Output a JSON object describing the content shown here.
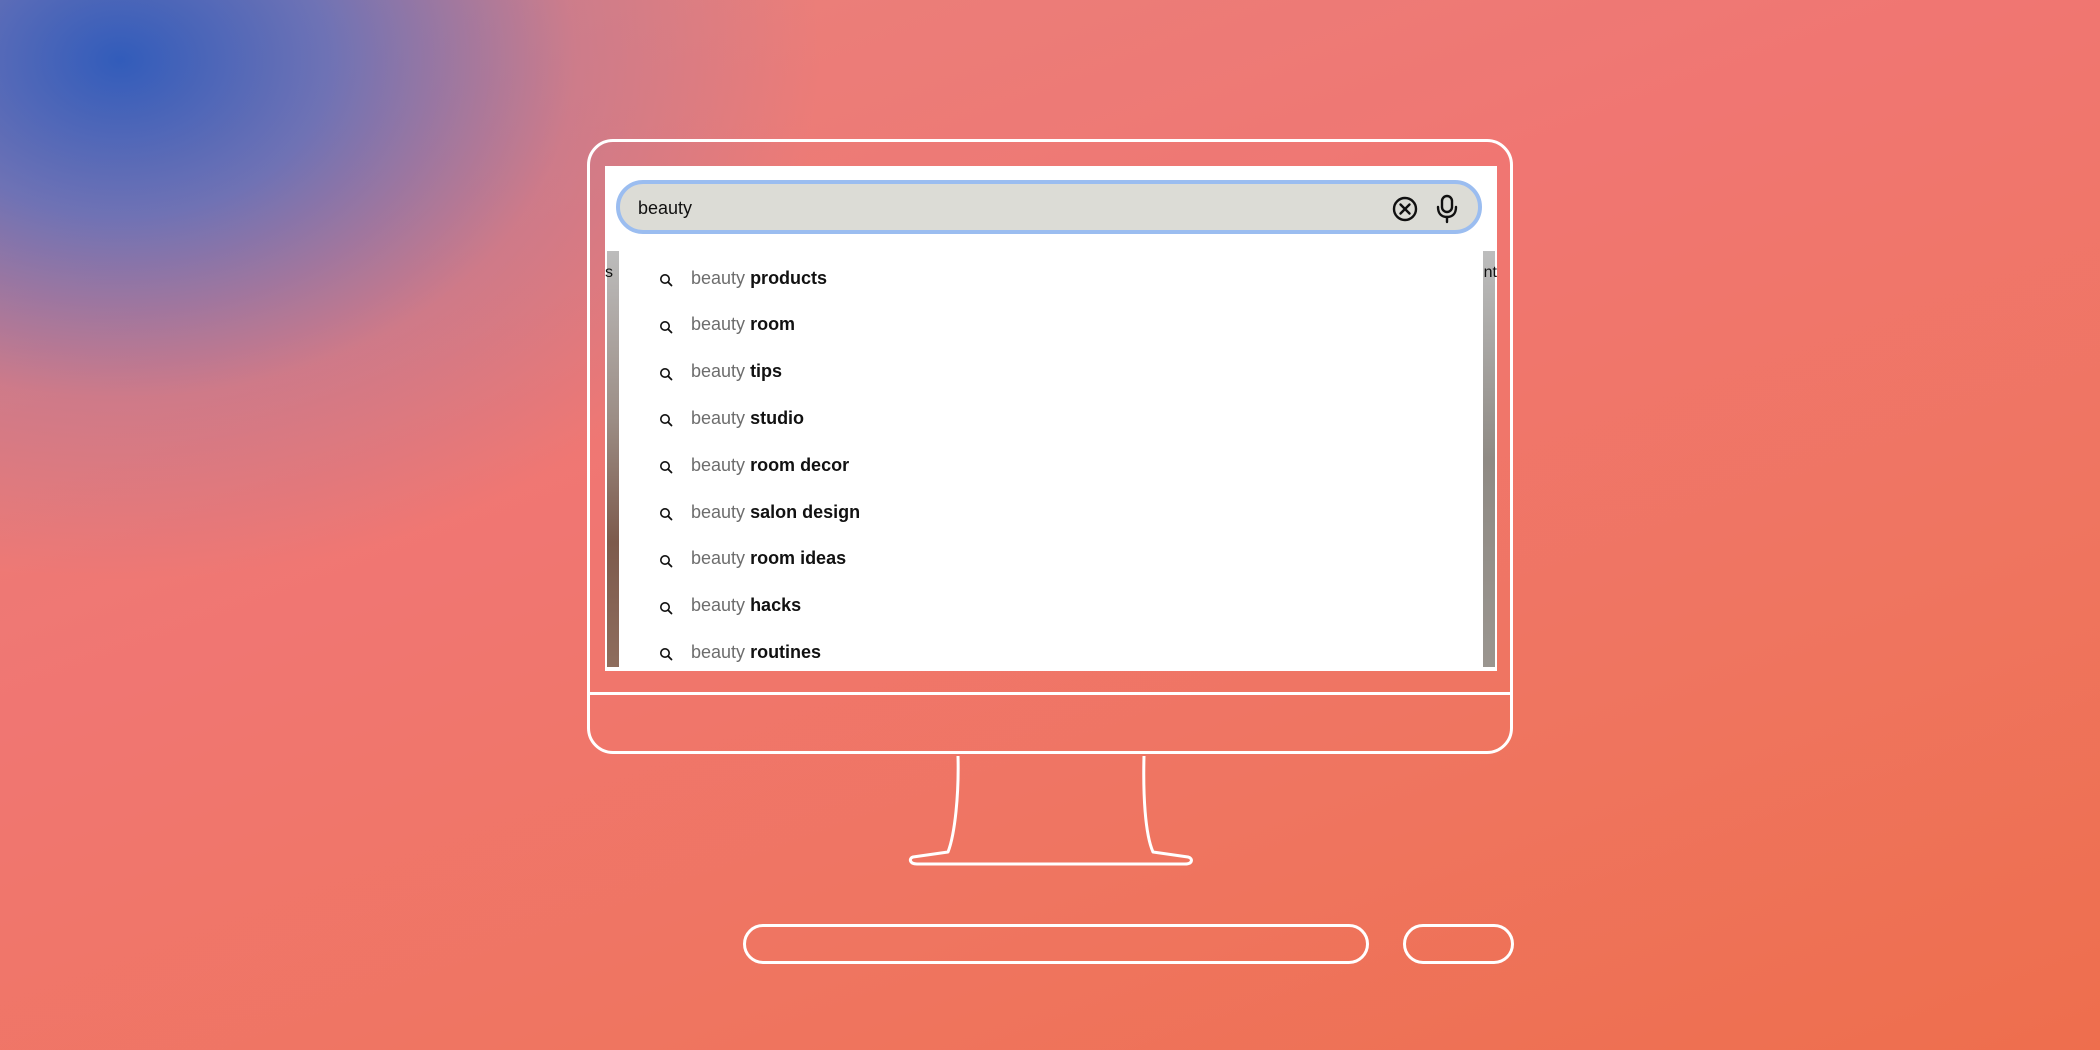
{
  "search": {
    "value": "beauty",
    "clear_icon": "clear-circle-x-icon",
    "mic_icon": "microphone-icon"
  },
  "background_fragments": {
    "left": "s",
    "right": "nt"
  },
  "suggestions": [
    {
      "prefix": "beauty",
      "suffix": "products",
      "icon": "search-icon"
    },
    {
      "prefix": "beauty",
      "suffix": "room",
      "icon": "search-icon"
    },
    {
      "prefix": "beauty",
      "suffix": "tips",
      "icon": "search-icon"
    },
    {
      "prefix": "beauty",
      "suffix": "studio",
      "icon": "search-icon"
    },
    {
      "prefix": "beauty",
      "suffix": "room decor",
      "icon": "search-icon"
    },
    {
      "prefix": "beauty",
      "suffix": "salon design",
      "icon": "search-icon"
    },
    {
      "prefix": "beauty",
      "suffix": "room ideas",
      "icon": "search-icon"
    },
    {
      "prefix": "beauty",
      "suffix": "hacks",
      "icon": "search-icon"
    },
    {
      "prefix": "beauty",
      "suffix": "routines",
      "icon": "search-icon"
    }
  ],
  "colors": {
    "focus_ring": "#9bbdf0",
    "search_fill": "#dcdcd6",
    "outline": "#ffffff"
  }
}
